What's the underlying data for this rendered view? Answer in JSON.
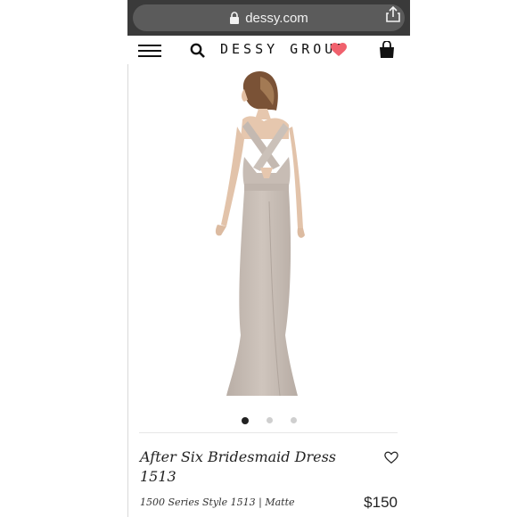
{
  "browser": {
    "url": "dessy.com"
  },
  "header": {
    "brand": "DESSY GROUP"
  },
  "product": {
    "title": "After Six Bridesmaid Dress 1513",
    "subtitle": "1500 Series Style 1513 | Matte",
    "price": "$150",
    "gallery": {
      "current": 1,
      "total": 3
    }
  },
  "colors": {
    "accent_heart": "#f0616d",
    "dress": "#c8beb6",
    "url_bar": "#5b5b5b"
  }
}
